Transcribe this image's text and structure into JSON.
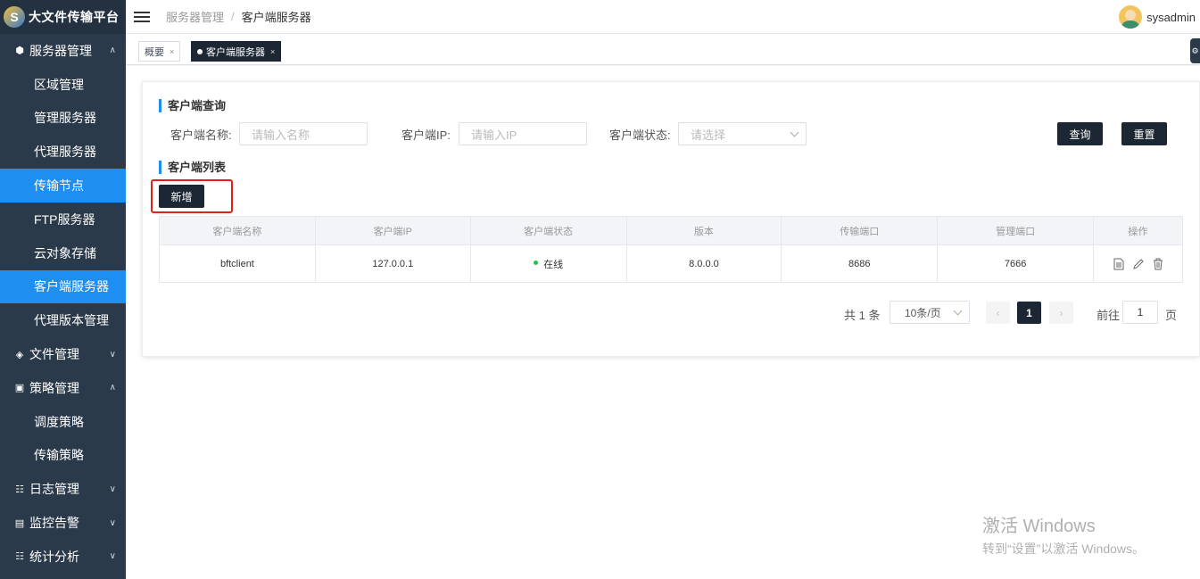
{
  "app": {
    "title": "大文件传输平台"
  },
  "header": {
    "breadcrumb": [
      "服务器管理",
      "客户端服务器"
    ],
    "breadcrumb_sep": "/",
    "user": "sysadmin"
  },
  "sidebar": {
    "items": [
      {
        "label": "服务器管理",
        "type": "group",
        "icon": "cube-icon",
        "expanded": true
      },
      {
        "label": "区域管理",
        "type": "sub"
      },
      {
        "label": "管理服务器",
        "type": "sub"
      },
      {
        "label": "代理服务器",
        "type": "sub"
      },
      {
        "label": "传输节点",
        "type": "sub",
        "active": true
      },
      {
        "label": "FTP服务器",
        "type": "sub"
      },
      {
        "label": "云对象存储",
        "type": "sub"
      },
      {
        "label": "客户端服务器",
        "type": "sub",
        "active": true
      },
      {
        "label": "代理版本管理",
        "type": "sub"
      },
      {
        "label": "文件管理",
        "type": "group",
        "icon": "layers-icon",
        "expanded": false
      },
      {
        "label": "策略管理",
        "type": "group",
        "icon": "policy-icon",
        "expanded": true
      },
      {
        "label": "调度策略",
        "type": "sub"
      },
      {
        "label": "传输策略",
        "type": "sub"
      },
      {
        "label": "日志管理",
        "type": "group",
        "icon": "log-icon",
        "expanded": false
      },
      {
        "label": "监控告警",
        "type": "group",
        "icon": "monitor-icon",
        "expanded": false
      },
      {
        "label": "统计分析",
        "type": "group",
        "icon": "stats-icon",
        "expanded": false
      }
    ]
  },
  "tags": {
    "overview": "概要",
    "current": "客户端服务器",
    "close": "×"
  },
  "query": {
    "title": "客户端查询",
    "name_label": "客户端名称:",
    "name_placeholder": "请输入名称",
    "ip_label": "客户端IP:",
    "ip_placeholder": "请输入IP",
    "status_label": "客户端状态:",
    "status_placeholder": "请选择",
    "search_button": "查询",
    "reset_button": "重置"
  },
  "list": {
    "title": "客户端列表",
    "add_button": "新增",
    "columns": [
      "客户端名称",
      "客户端IP",
      "客户端状态",
      "版本",
      "传输端口",
      "管理端口",
      "操作"
    ],
    "rows": [
      {
        "name": "bftclient",
        "ip": "127.0.0.1",
        "status": "在线",
        "version": "8.0.0.0",
        "transfer_port": "8686",
        "manage_port": "7666"
      }
    ]
  },
  "pagination": {
    "total": "共 1 条",
    "page_size": "10条/页",
    "current_page": "1",
    "goto_label": "前往",
    "goto_value": "1",
    "page_suffix": "页"
  },
  "watermark": {
    "line1": "激活 Windows",
    "line2": "转到“设置”以激活 Windows。"
  },
  "colors": {
    "sidebar_bg": "#2b3a4a",
    "accent": "#1e8ef0",
    "dark_button": "#1d2733",
    "online": "#27c24c",
    "highlight": "#e0201b"
  }
}
